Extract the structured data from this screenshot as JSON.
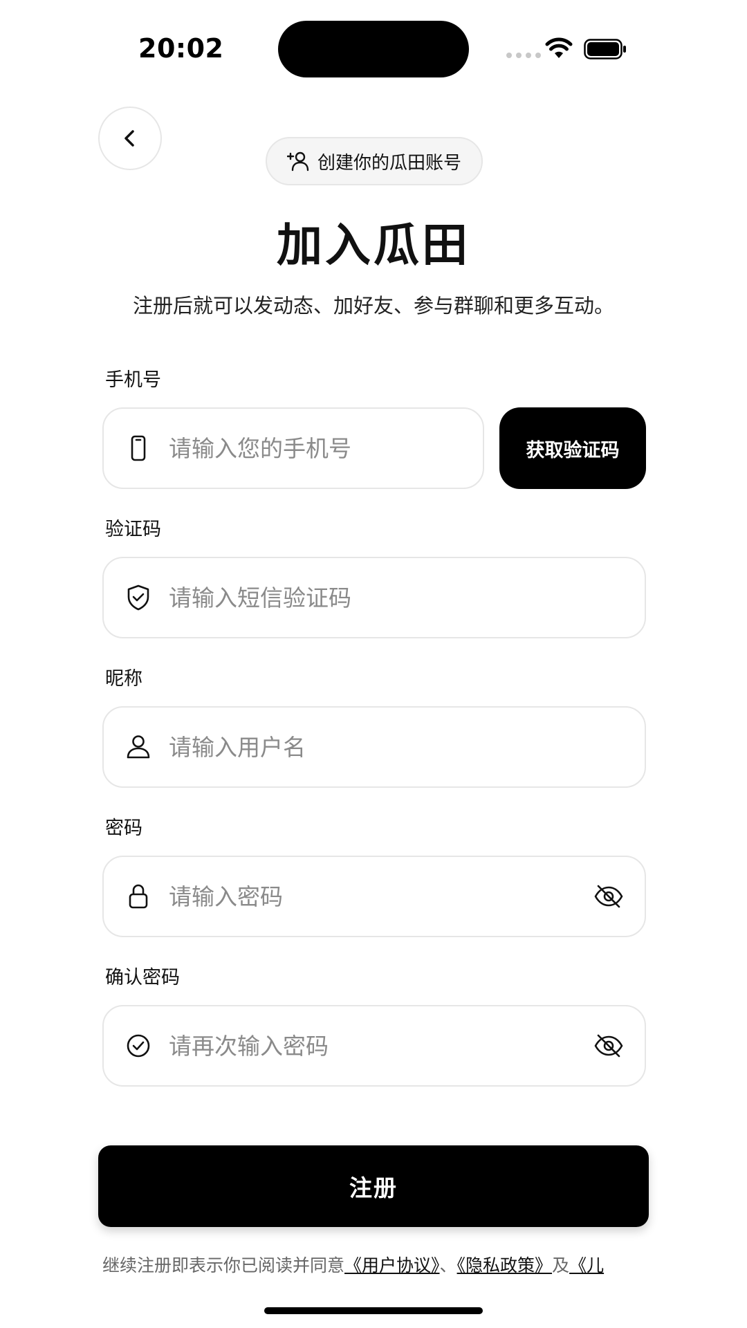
{
  "status_bar": {
    "time": "20:02"
  },
  "header": {
    "pill_text": "创建你的瓜田账号",
    "title": "加入瓜田",
    "subtitle": "注册后就可以发动态、加好友、参与群聊和更多互动。"
  },
  "form": {
    "phone": {
      "label": "手机号",
      "value": "",
      "placeholder": "请输入您的手机号",
      "icon": "phone-icon",
      "code_button": "获取验证码"
    },
    "code": {
      "label": "验证码",
      "value": "",
      "placeholder": "请输入短信验证码",
      "icon": "shield-check-icon"
    },
    "nickname": {
      "label": "昵称",
      "value": "",
      "placeholder": "请输入用户名",
      "icon": "user-icon"
    },
    "password": {
      "label": "密码",
      "value": "",
      "placeholder": "请输入密码",
      "icon": "lock-icon",
      "toggle_icon": "eye-off-icon"
    },
    "confirm_password": {
      "label": "确认密码",
      "value": "",
      "placeholder": "请再次输入密码",
      "icon": "check-circle-icon",
      "toggle_icon": "eye-off-icon"
    }
  },
  "actions": {
    "register": "注册"
  },
  "agreement": {
    "prefix": "继续注册即表示你已阅读并同意",
    "user_agreement": "《用户协议》",
    "sep1": "、",
    "privacy_policy": "《隐私政策》",
    "sep2": "及",
    "children_policy": "《儿"
  },
  "colors": {
    "primary": "#000000",
    "border": "#e6e6e6",
    "placeholder": "#8a8a8a",
    "background": "#ffffff"
  }
}
